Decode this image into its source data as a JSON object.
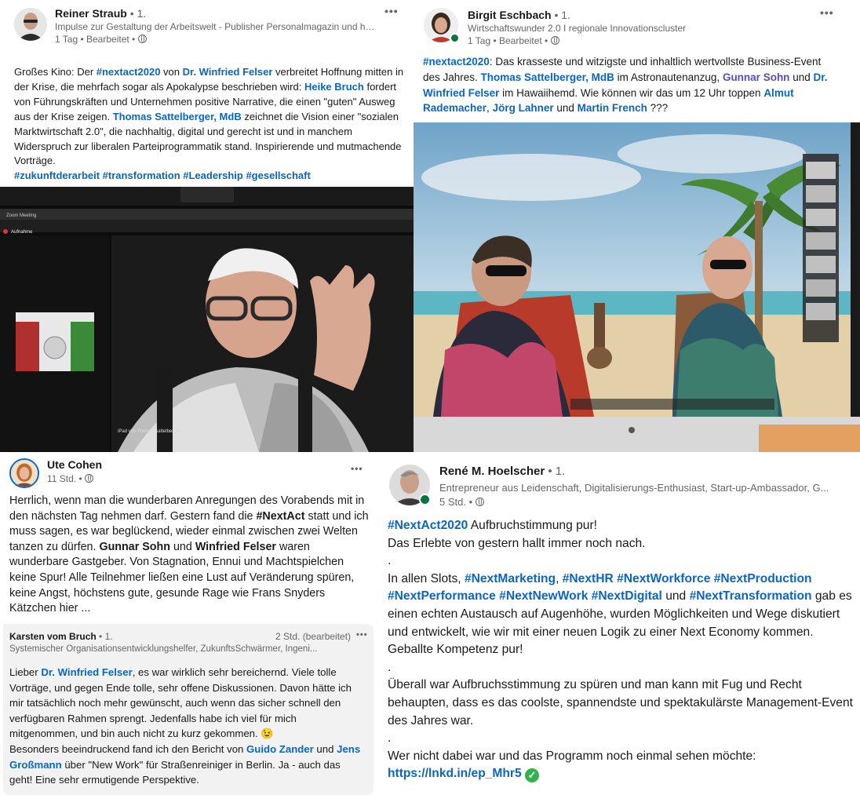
{
  "post1": {
    "author": "Reiner Straub",
    "degree": "• 1.",
    "headline": "Impulse zur Gestaltung der Arbeitswelt - Publisher Personalmagazin und haufe....",
    "meta": "1 Tag • Bearbeitet •",
    "menu": "•••",
    "t1": "Großes Kino: Der ",
    "tag_nextact": "#nextact2020",
    "t2": " von ",
    "m_felser": "Dr. Winfried Felser",
    "t3": " verbreitet Hoffnung mitten in der Krise, die mehrfach sogar als Apokalypse beschrieben wird: ",
    "m_bruch": "Heike Bruch",
    "t4": " fordert von Führungskräften und Unternehmen positive Narrative, die einen \"guten\" Ausweg aus der Krise zeigen. ",
    "m_sattelberger": "Thomas Sattelberger, MdB",
    "t5": " zeichnet die Vision einer \"sozialen Marktwirtschaft 2.0\", die nachhaltig, digital und gerecht ist und in manchem Widerspruch zur liberalen Parteiprogrammatik stand. Inspirierende und mutmachende Vorträge.",
    "hashtags": "#zukunftderarbeit #transformation #Leadership #gesellschaft",
    "screen_label": "Zoom Meeting",
    "rec_label": "Aufnahme",
    "ipad_label": "iPad von Thomas sattelberger"
  },
  "post2": {
    "author": "Birgit Eschbach",
    "degree": "• 1.",
    "headline": "Wirtschaftswunder 2.0 I regionale Innovationscluster",
    "meta": "1 Tag • Bearbeitet •",
    "menu": "•••",
    "tag_nextact": "#nextact2020",
    "t1": ": Das krasseste und witzigste und inhaltlich wertvollste Business-Event des Jahres. ",
    "m_sattelberger": "Thomas Sattelberger, MdB",
    "t2": " im Astronautenanzug, ",
    "m_sohn": "Gunnar Sohn",
    "t3": " und ",
    "m_felser": "Dr. Winfried Felser",
    "t4": " im Hawaiihemd. Wie können wir das um 12 Uhr toppen ",
    "m_rademacher": "Almut Rademacher",
    "t5": ", ",
    "m_lahner": "Jörg Lahner",
    "t6": " und ",
    "m_french": "Martin French",
    "t7": " ???"
  },
  "post3": {
    "author": "Ute Cohen",
    "meta": "11 Std. •",
    "menu": "•••",
    "t1": "Herrlich, wenn man die wunderbaren Anregungen des Vorabends mit in den nächsten Tag nehmen darf. Gestern fand die ",
    "b_nextact": "#NextAct",
    "t2": " statt und ich muss sagen, es war beglückend, wieder einmal zwischen zwei Welten tanzen zu dürfen. ",
    "b_sohn": "Gunnar Sohn",
    "t3": " und ",
    "b_felser": "Winfried Felser",
    "t4": " waren wunderbare Gastgeber. Von Stagnation, Ennui und Machtspielchen keine Spur! Alle Teilnehmer ließen eine Lust auf Veränderung spüren, keine Angst, höchstens gute, gesunde Rage wie  Frans Snyders Kätzchen hier ..."
  },
  "comment": {
    "author": "Karsten vom Bruch",
    "degree": "• 1.",
    "time": "2 Std. (bearbeitet)",
    "menu": "•••",
    "headline": "Systemischer Organisationsentwicklungshelfer, ZukunftsSchwärmer, Ingeni...",
    "t1": "Lieber ",
    "m_felser": "Dr. Winfried Felser",
    "t2": ", es war wirklich sehr bereichernd. Viele tolle Vorträge, und gegen Ende tolle, sehr offene Diskussionen. Davon hätte ich mir tatsächlich noch mehr gewünscht, auch wenn das sicher schnell den verfügbaren Rahmen sprengt. Jedenfalls habe ich viel für mich mitgenommen, und bin auch nicht zu kurz gekommen. ",
    "emoji": "😉",
    "t3": "Besonders beeindruckend fand ich den Bericht von ",
    "m_zander": "Guido Zander",
    "t4": " und ",
    "m_grossmann": "Jens Großmann",
    "t5": " über \"New Work\" für Straßenreiniger in Berlin. Ja - auch das geht! Eine sehr ermutigende Perspektive."
  },
  "post4": {
    "author": "René M. Hoelscher",
    "degree": "• 1.",
    "headline": "Entrepreneur aus Leidenschaft, Digitalisierungs-Enthusiast, Start-up-Ambassador, G...",
    "meta": "5 Std. •",
    "line1_tag": "#NextAct2020",
    "line1_text": " Aufbruchstimmung pur!",
    "line2": "Das Erlebte von gestern hallt immer noch nach.",
    "dot": ".",
    "p2_t1": "In allen Slots, ",
    "tag_marketing": "#NextMarketing",
    "p2_comma": ", ",
    "tag_hr": "#NextHR",
    "tag_workforce": "#NextWorkforce",
    "tag_production": "#NextProduction",
    "tag_performance": "#NextPerformance",
    "tag_newwork": "#NextNewWork",
    "tag_digital": "#NextDigital",
    "p2_und": " und ",
    "tag_transformation": "#NextTransformation",
    "p2_t2": " gab es einen echten Austausch auf Augenhöhe, wurden Möglichkeiten und Wege diskutiert und entwickelt, wie wir mit einer neuen Logik zu einer Next Economy kommen. Geballte Kompetenz pur!",
    "p3": "Überall war Aufbruchsstimmung zu spüren und man kann mit Fug und Recht behaupten, dass es das coolste, spannendste und spektakulärste Management-Event des Jahres war.",
    "p4": "Wer nicht dabei war und das Programm noch einmal sehen möchte:",
    "url": "https://lnkd.in/ep_Mhr5",
    "check": "✓"
  },
  "colors": {
    "link": "#0a66c2",
    "text": "#191919",
    "muted": "#666666",
    "online": "#057642"
  }
}
